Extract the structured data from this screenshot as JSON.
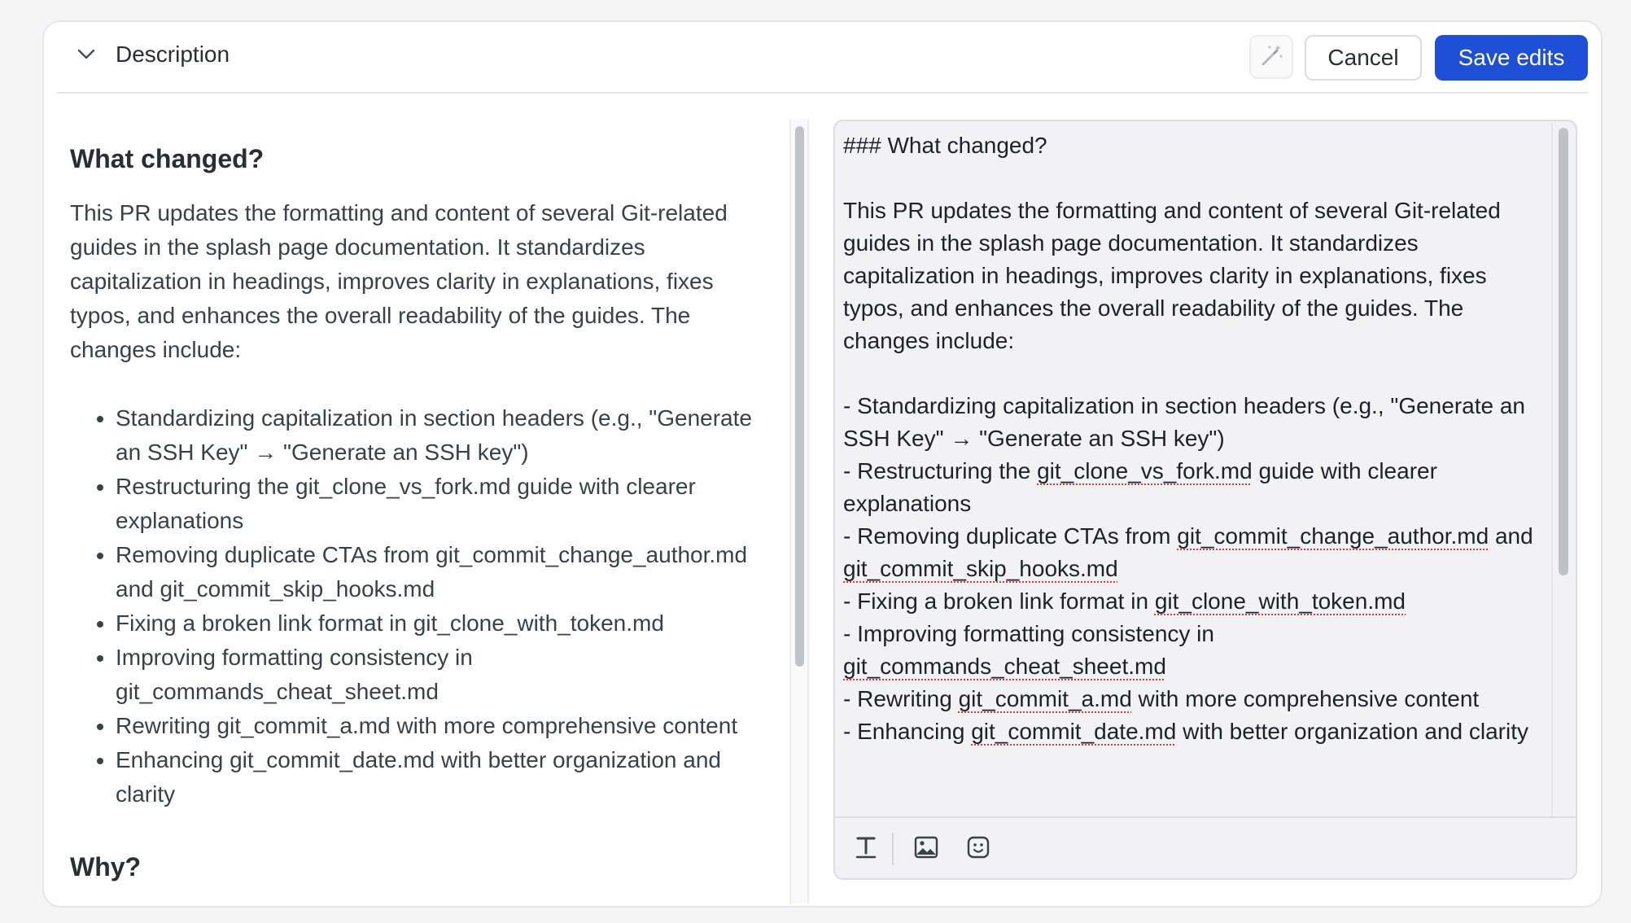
{
  "header": {
    "title": "Description",
    "cancel_label": "Cancel",
    "save_label": "Save edits",
    "icons": {
      "collapse": "chevron-down-icon",
      "ai_assist": "magic-wand-icon"
    }
  },
  "preview": {
    "heading_what": "What changed?",
    "paragraph": "This PR updates the formatting and content of several Git-related guides in the splash page documentation. It standardizes capitalization in headings, improves clarity in explanations, fixes typos, and enhances the overall readability of the guides. The changes include:",
    "items": [
      "Standardizing capitalization in section headers (e.g., \"Generate an SSH Key\" → \"Generate an SSH key\")",
      "Restructuring the git_clone_vs_fork.md guide with clearer explanations",
      "Removing duplicate CTAs from git_commit_change_author.md and git_commit_skip_hooks.md",
      "Fixing a broken link format in git_clone_with_token.md",
      "Improving formatting consistency in git_commands_cheat_sheet.md",
      "Rewriting git_commit_a.md with more comprehensive content",
      "Enhancing git_commit_date.md with better organization and clarity"
    ],
    "heading_why": "Why?"
  },
  "editor": {
    "line_heading": "### What changed?",
    "paragraph": "This PR updates the formatting and content of several Git-related guides in the splash page documentation. It standardizes capitalization in headings, improves clarity in explanations, fixes typos, and enhances the overall readability of the guides. The changes include:",
    "lines": [
      {
        "pre": "- Standardizing capitalization in section headers (e.g., \"Generate an SSH Key\" → \"Generate an SSH key\")"
      },
      {
        "pre": "- Restructuring the ",
        "file": "git_clone_vs_fork.md",
        "post": " guide with clearer explanations"
      },
      {
        "pre": "- Removing duplicate CTAs from ",
        "file": "git_commit_change_author.md",
        "mid": " and ",
        "file2": "git_commit_skip_hooks.md"
      },
      {
        "pre": "- Fixing a broken link format in ",
        "file": "git_clone_with_token.md"
      },
      {
        "pre": "- Improving formatting consistency in ",
        "file": "git_commands_cheat_sheet.md"
      },
      {
        "pre": "- Rewriting ",
        "file": "git_commit_a.md",
        "post": " with more comprehensive content"
      },
      {
        "pre": "- Enhancing ",
        "file": "git_commit_date.md",
        "post": " with better organization and clarity"
      }
    ],
    "toolbar": {
      "icons": [
        "text-format-icon",
        "image-icon",
        "emoji-icon"
      ]
    }
  }
}
